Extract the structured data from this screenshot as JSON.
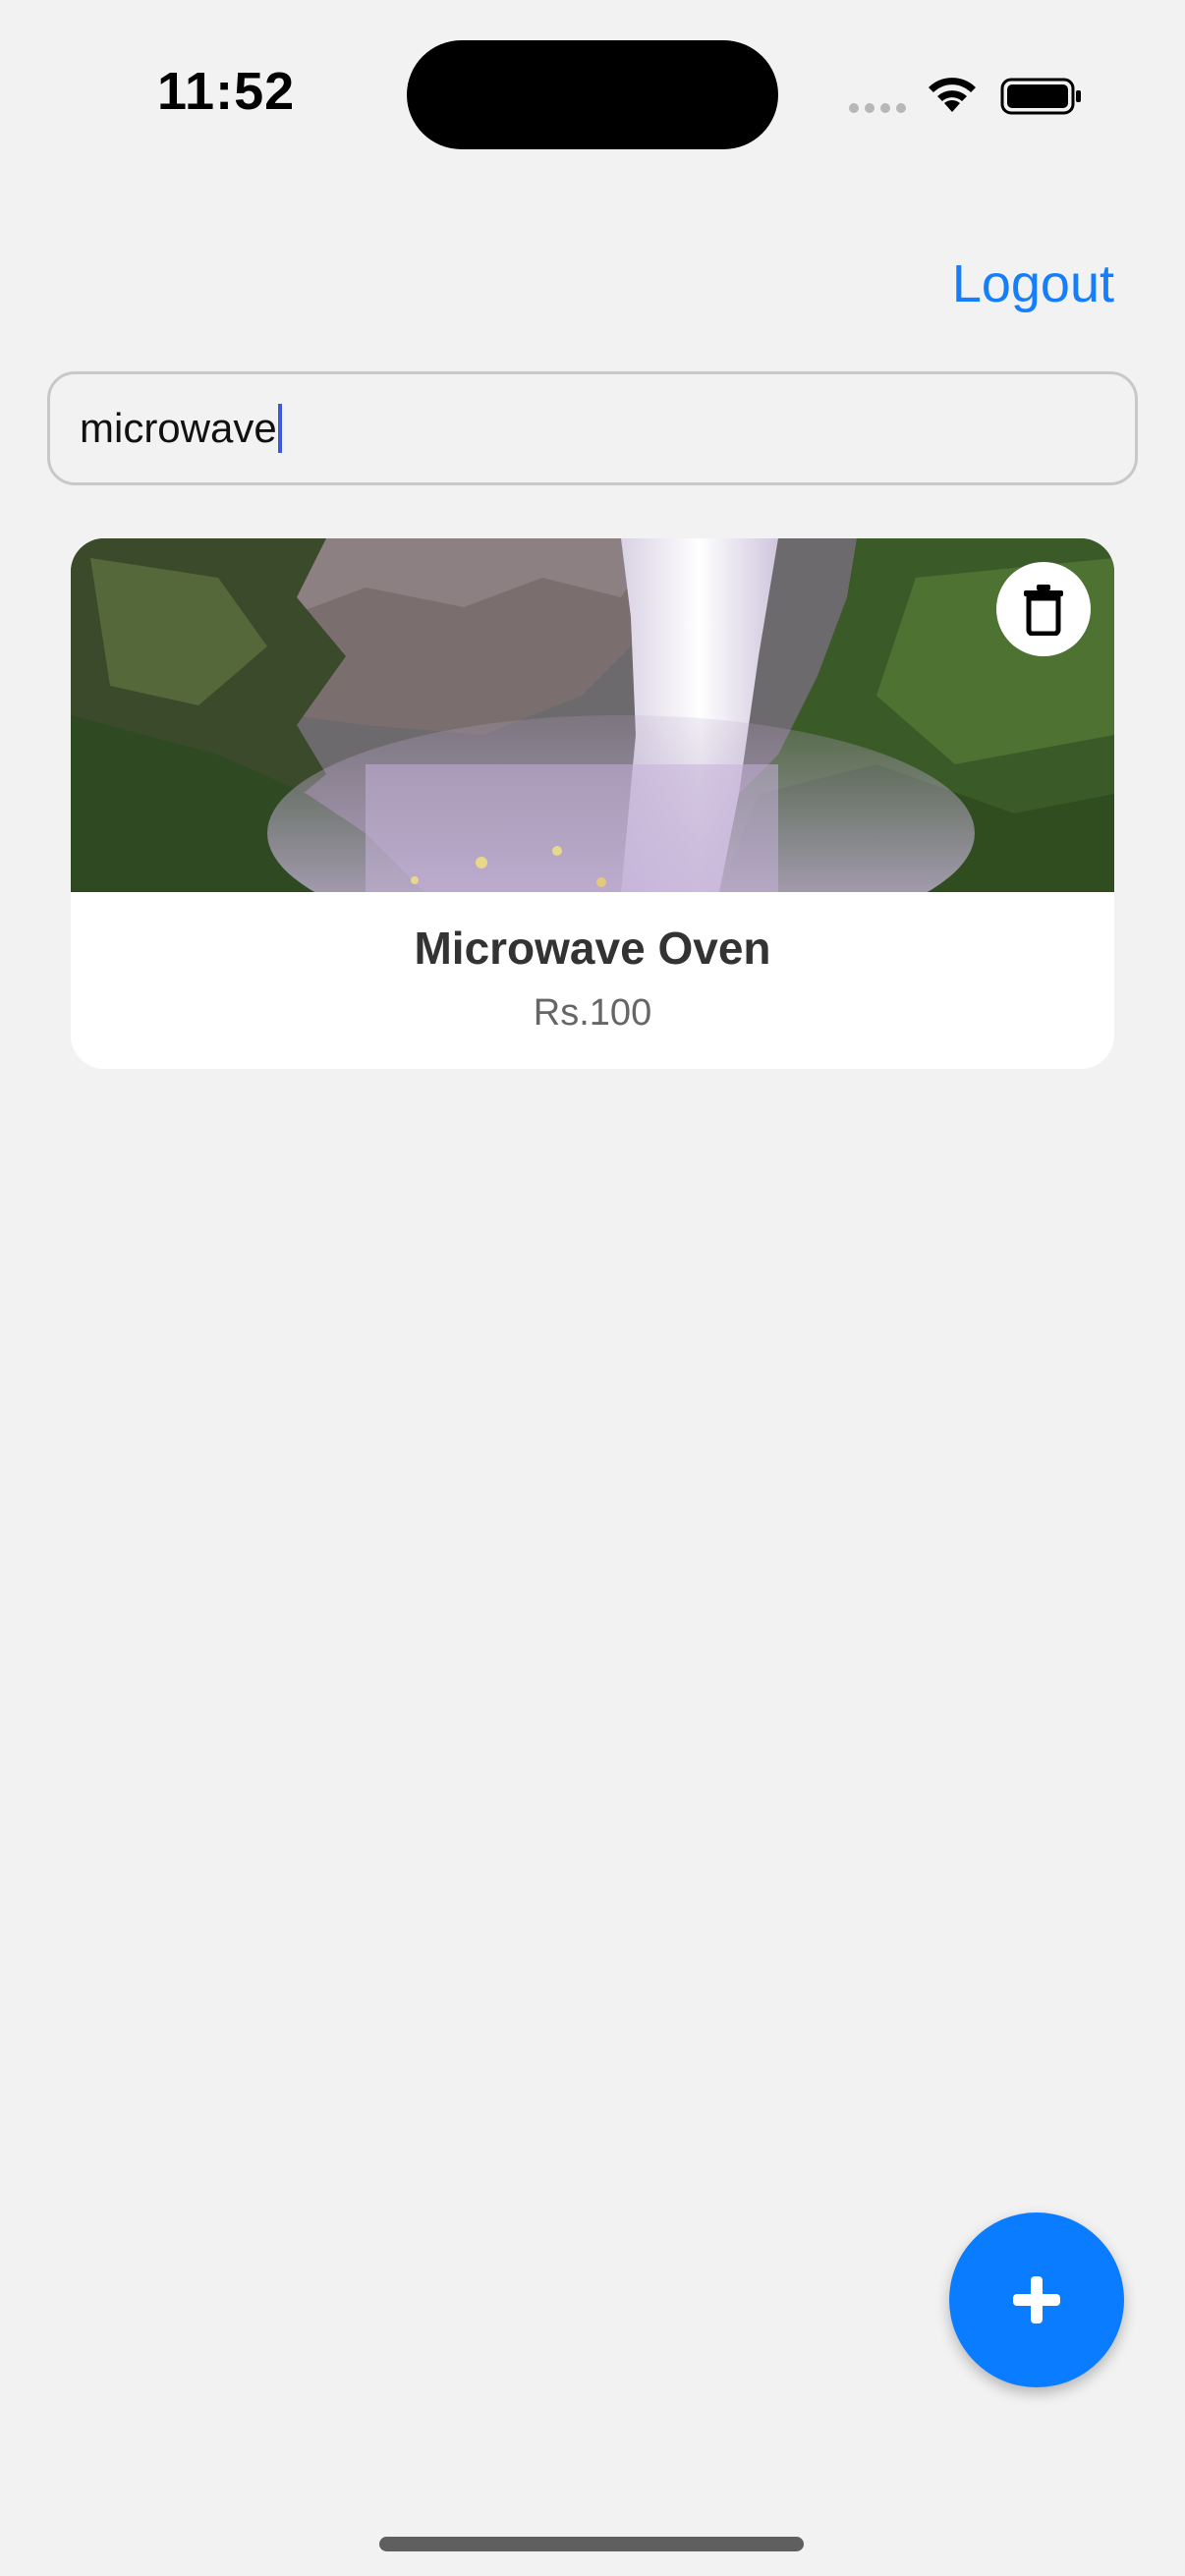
{
  "status_bar": {
    "time": "11:52"
  },
  "header": {
    "logout_label": "Logout"
  },
  "search": {
    "value": "microwave"
  },
  "products": [
    {
      "title": "Microwave Oven",
      "price": "Rs.100",
      "image": "waterfall-photo"
    }
  ],
  "icons": {
    "delete": "trash-icon",
    "add": "plus-icon",
    "wifi": "wifi-icon",
    "battery": "battery-icon"
  },
  "colors": {
    "accent": "#147efb",
    "fab": "#0a7cff",
    "background": "#f2f2f2"
  }
}
